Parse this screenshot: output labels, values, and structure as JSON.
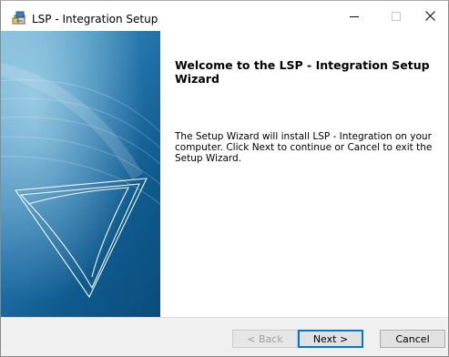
{
  "window": {
    "title": "LSP - Integration Setup",
    "controls": {
      "minimize": "minimize",
      "maximize": "maximize",
      "close": "close"
    }
  },
  "wizard": {
    "heading": "Welcome to the LSP - Integration Setup Wizard",
    "body": "The Setup Wizard will install LSP - Integration on your computer. Click Next to continue or Cancel to exit the Setup Wizard."
  },
  "footer": {
    "back": {
      "label": "< Back",
      "enabled": false
    },
    "next": {
      "label": "Next >",
      "enabled": true
    },
    "cancel": {
      "label": "Cancel",
      "enabled": true
    }
  },
  "icons": {
    "app": "installer-icon",
    "close": "close-icon",
    "minimize": "minimize-icon",
    "maximize": "maximize-icon"
  },
  "colors": {
    "banner_dark": "#0a4c7b",
    "banner_light": "#6fb0d2",
    "focus_border": "#0078d7"
  }
}
